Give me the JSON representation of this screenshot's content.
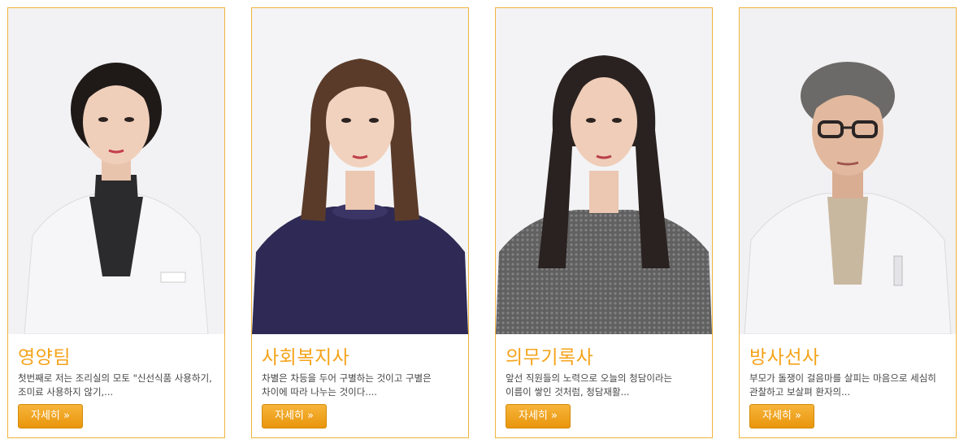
{
  "cards": [
    {
      "title": "영양팀",
      "description": "첫번째로 저는 조리실의 모토 \"신선식품 사용하기,조미료 사용하지 않기,...",
      "button_label": "자세히 »",
      "photo_icon": "staff-portrait-nutritionist"
    },
    {
      "title": "사회복지사",
      "description": "차별은 차등을 두어 구별하는 것이고 구별은 차이에 따라 나누는 것이다....",
      "button_label": "자세히 »",
      "photo_icon": "staff-portrait-social-worker"
    },
    {
      "title": "의무기록사",
      "description": "앞선 직원들의 노력으로 오늘의 청담이라는 이름이 쌓인 것처럼, 청담재활...",
      "button_label": "자세히 »",
      "photo_icon": "staff-portrait-medical-records"
    },
    {
      "title": "방사선사",
      "description": "부모가 돌쟁이 걸음마를 살피는 마음으로 세심히 관찰하고 보살펴 환자의...",
      "button_label": "자세히 »",
      "photo_icon": "staff-portrait-radiologist"
    }
  ],
  "colors": {
    "accent": "#f5a31a",
    "border": "#f0b43c",
    "button": "#eea21e"
  }
}
